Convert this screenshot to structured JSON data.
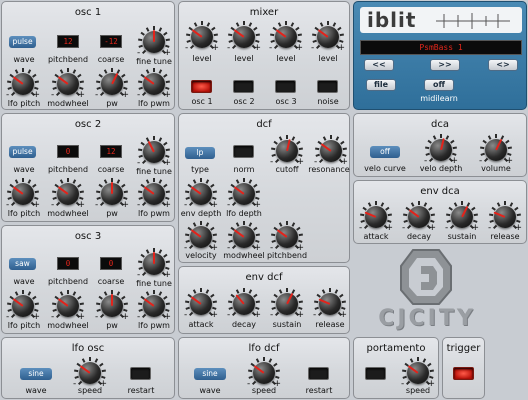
{
  "osc1": {
    "title": "osc 1",
    "wave": "pulse",
    "pitchbend": "12",
    "coarse": "-12",
    "labels": {
      "wave": "wave",
      "pitchbend": "pitchbend",
      "coarse": "coarse",
      "fine_tune": "fine tune",
      "lfo_pitch": "lfo pitch",
      "modwheel": "modwheel",
      "pw": "pw",
      "lfo_pwm": "lfo pwm"
    }
  },
  "osc2": {
    "title": "osc 2",
    "wave": "pulse",
    "pitchbend": "0",
    "coarse": "12",
    "labels": {
      "wave": "wave",
      "pitchbend": "pitchbend",
      "coarse": "coarse",
      "fine_tune": "fine tune",
      "lfo_pitch": "lfo pitch",
      "modwheel": "modwheel",
      "pw": "pw",
      "lfo_pwm": "lfo pwm"
    }
  },
  "osc3": {
    "title": "osc 3",
    "wave": "saw",
    "pitchbend": "0",
    "coarse": "0",
    "labels": {
      "wave": "wave",
      "pitchbend": "pitchbend",
      "coarse": "coarse",
      "fine_tune": "fine tune",
      "lfo_pitch": "lfo pitch",
      "modwheel": "modwheel",
      "pw": "pw",
      "lfo_pwm": "lfo pwm"
    }
  },
  "mixer": {
    "title": "mixer",
    "level": "level",
    "osc1": "osc 1",
    "osc2": "osc 2",
    "osc3": "osc 3",
    "noise": "noise"
  },
  "dcf": {
    "title": "dcf",
    "type_value": "lp",
    "type": "type",
    "norm": "norm",
    "cutoff": "cutoff",
    "resonance": "resonance",
    "env_depth": "env depth",
    "lfo_depth": "lfo depth",
    "velocity": "velocity",
    "modwheel": "modwheel",
    "pitchbend": "pitchbend"
  },
  "env_dcf": {
    "title": "env dcf",
    "attack": "attack",
    "decay": "decay",
    "sustain": "sustain",
    "release": "release"
  },
  "dca": {
    "title": "dca",
    "velo_value": "off",
    "velo_curve": "velo  curve",
    "velo_depth": "velo depth",
    "volume": "volume"
  },
  "env_dca": {
    "title": "env dca",
    "attack": "attack",
    "decay": "decay",
    "sustain": "sustain",
    "release": "release"
  },
  "lfo_osc": {
    "title": "lfo osc",
    "wave_value": "sine",
    "wave": "wave",
    "speed": "speed",
    "restart": "restart"
  },
  "lfo_dcf": {
    "title": "lfo dcf",
    "wave_value": "sine",
    "wave": "wave",
    "speed": "speed",
    "restart": "restart"
  },
  "portamento": {
    "title": "portamento",
    "speed": "speed"
  },
  "trigger": {
    "title": "trigger"
  },
  "header": {
    "logo": "iblit",
    "preset": "PsmBass 1",
    "prev": "<<",
    "next": ">>",
    "swap": "<>",
    "file": "file",
    "midi_value": "off",
    "midilearn": "midilearn"
  },
  "watermark": {
    "text": "CJCITY"
  },
  "colors": {
    "accent": "#2f5f8f",
    "lcd_text": "#e0261b",
    "led_on": "#ff4a3a",
    "header_bg": "#3a7ca8"
  },
  "knobs": {
    "osc1_fine": 0.5,
    "osc1_lfo_pitch": 0.3,
    "osc1_modwheel": 0.3,
    "osc1_pw": 0.6,
    "osc1_lfo_pwm": 0.3,
    "osc2_fine": 0.4,
    "osc2_lfo_pitch": 0.3,
    "osc2_modwheel": 0.3,
    "osc2_pw": 0.5,
    "osc2_lfo_pwm": 0.3,
    "osc3_fine": 0.5,
    "osc3_lfo_pitch": 0.3,
    "osc3_modwheel": 0.3,
    "osc3_pw": 0.5,
    "osc3_lfo_pwm": 0.3,
    "mix_l1": 0.3,
    "mix_l2": 0.3,
    "mix_l3": 0.3,
    "mix_l4": 0.3,
    "dcf_cutoff": 0.55,
    "dcf_res": 0.3,
    "dcf_env": 0.3,
    "dcf_lfo": 0.3,
    "dcf_vel": 0.3,
    "dcf_mod": 0.3,
    "dcf_pb": 0.3,
    "edcf_a": 0.3,
    "edcf_d": 0.35,
    "edcf_s": 0.6,
    "edcf_r": 0.25,
    "dca_velo": 0.55,
    "dca_vol": 0.6,
    "edca_a": 0.25,
    "edca_d": 0.3,
    "edca_s": 0.6,
    "edca_r": 0.25,
    "lfo_osc_speed": 0.3,
    "lfo_dcf_speed": 0.3,
    "porta_speed": 0.3
  }
}
